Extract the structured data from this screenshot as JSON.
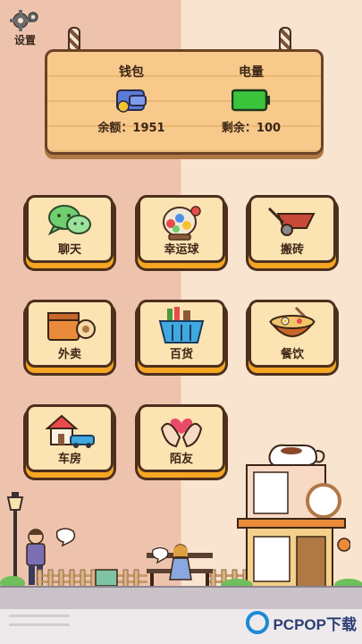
{
  "settings": {
    "label": "设置"
  },
  "wallet": {
    "title": "钱包",
    "balance_text": "余额：1951"
  },
  "battery": {
    "title": "电量",
    "remaining_text": "剩余：100",
    "level": 1.0
  },
  "apps": [
    {
      "label": "聊天",
      "icon": "chat-icon"
    },
    {
      "label": "幸运球",
      "icon": "lucky-ball-icon"
    },
    {
      "label": "搬砖",
      "icon": "wheelbarrow-icon"
    },
    {
      "label": "外卖",
      "icon": "delivery-box-icon"
    },
    {
      "label": "百货",
      "icon": "shopping-basket-icon"
    },
    {
      "label": "餐饮",
      "icon": "noodle-bowl-icon"
    },
    {
      "label": "车房",
      "icon": "house-car-icon"
    },
    {
      "label": "陌友",
      "icon": "heart-hands-icon"
    }
  ],
  "watermark": {
    "text": "PCPOP下载"
  },
  "colors": {
    "tile_bg": "#fbe3b2",
    "tile_shadow": "#f5a623",
    "outline": "#4d2f1d",
    "battery": "#3dc43d"
  }
}
